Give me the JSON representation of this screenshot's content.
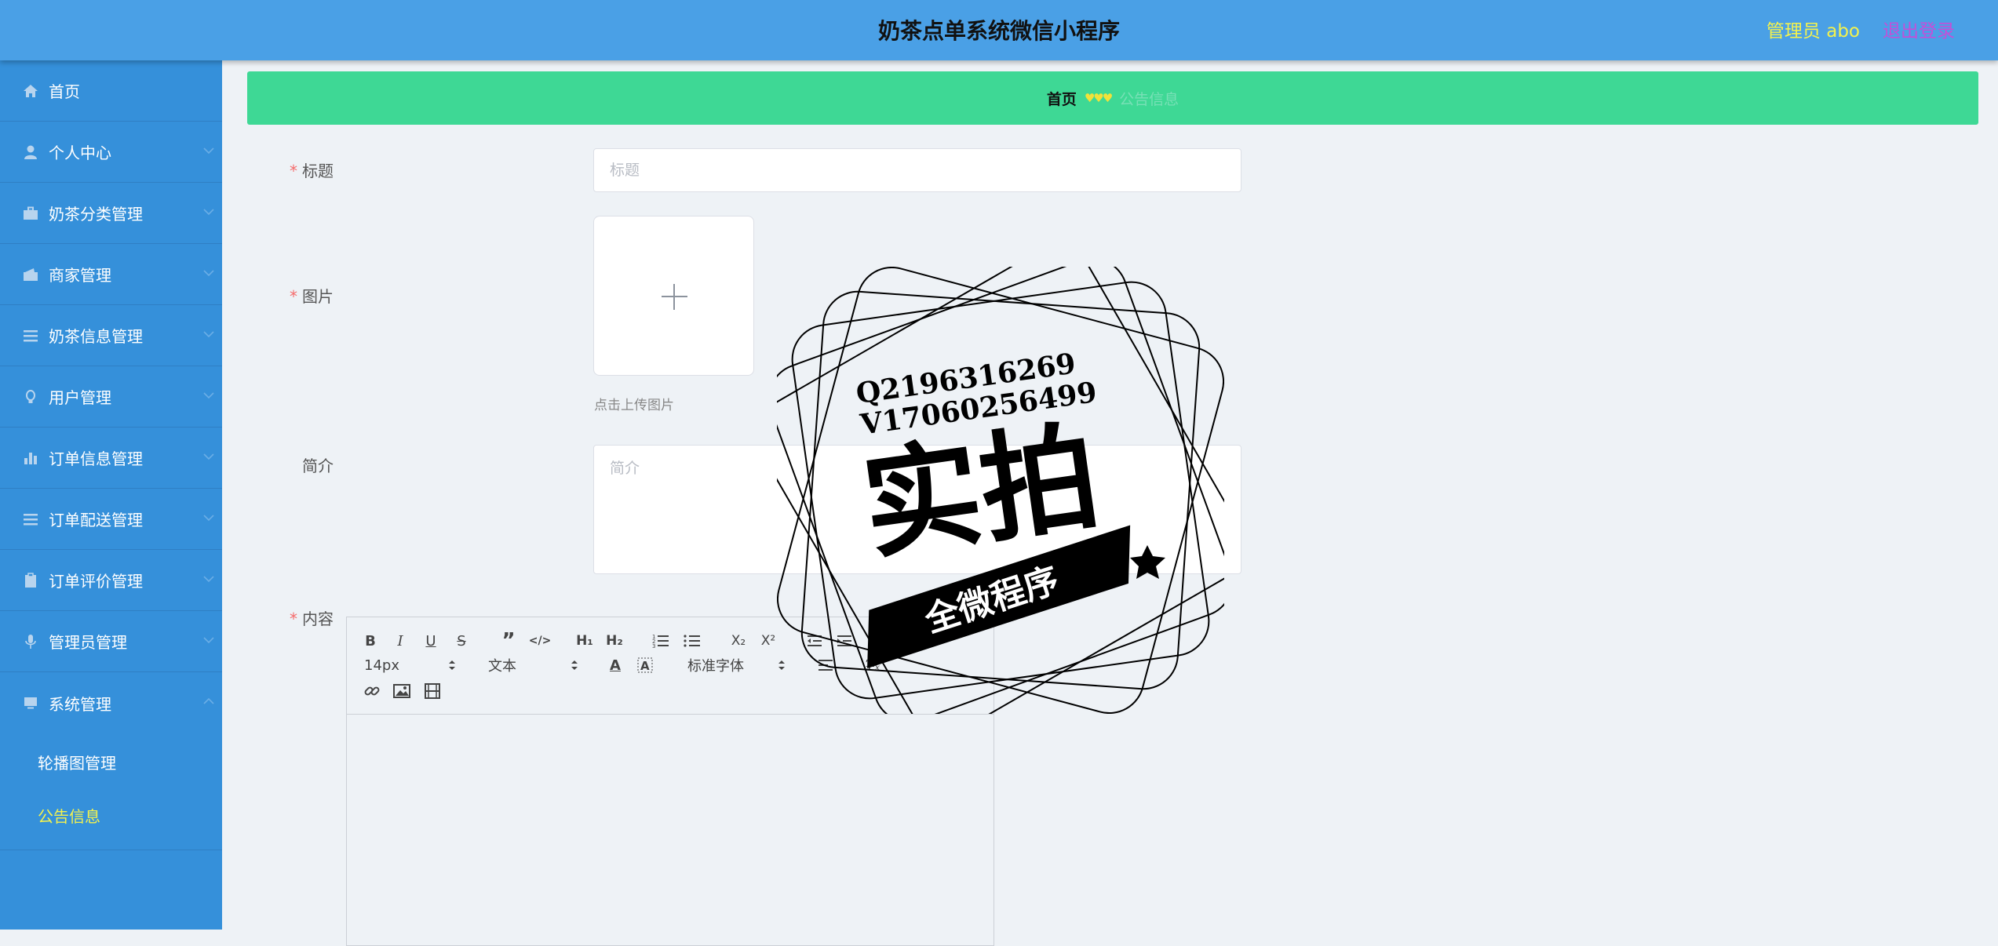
{
  "header": {
    "title": "奶茶点单系统微信小程序",
    "user_label": "管理员 abo",
    "logout_label": "退出登录"
  },
  "sidebar": {
    "items": [
      {
        "label": "首页",
        "icon": "home-icon"
      },
      {
        "label": "个人中心",
        "icon": "person-icon"
      },
      {
        "label": "奶茶分类管理",
        "icon": "briefcase-icon"
      },
      {
        "label": "商家管理",
        "icon": "wallet-icon"
      },
      {
        "label": "奶茶信息管理",
        "icon": "list-icon"
      },
      {
        "label": "用户管理",
        "icon": "bulb-icon"
      },
      {
        "label": "订单信息管理",
        "icon": "bar-chart-icon"
      },
      {
        "label": "订单配送管理",
        "icon": "list-icon"
      },
      {
        "label": "订单评价管理",
        "icon": "clipboard-icon"
      },
      {
        "label": "管理员管理",
        "icon": "mic-icon"
      },
      {
        "label": "系统管理",
        "icon": "monitor-icon"
      }
    ],
    "system_sub": [
      {
        "label": "轮播图管理"
      },
      {
        "label": "公告信息"
      }
    ]
  },
  "breadcrumb": {
    "home": "首页",
    "separator": "♥♥♥",
    "current": "公告信息"
  },
  "form": {
    "title_label": "标题",
    "title_placeholder": "标题",
    "image_label": "图片",
    "upload_hint": "点击上传图片",
    "intro_label": "简介",
    "intro_placeholder": "简介",
    "content_label": "内容"
  },
  "editor": {
    "font_size": "14px",
    "text_type": "文本",
    "font_family": "标准字体"
  },
  "watermark": {
    "line1": "Q2196316269",
    "line2": "V17060256499",
    "main": "实拍",
    "ribbon": "全微程序"
  },
  "colors": {
    "header_bg": "#4aa0e6",
    "sidebar_bg": "#3590da",
    "breadcrumb_bg": "#3ed895",
    "active_sub": "#f4f24d",
    "logout": "#c44fd8"
  }
}
